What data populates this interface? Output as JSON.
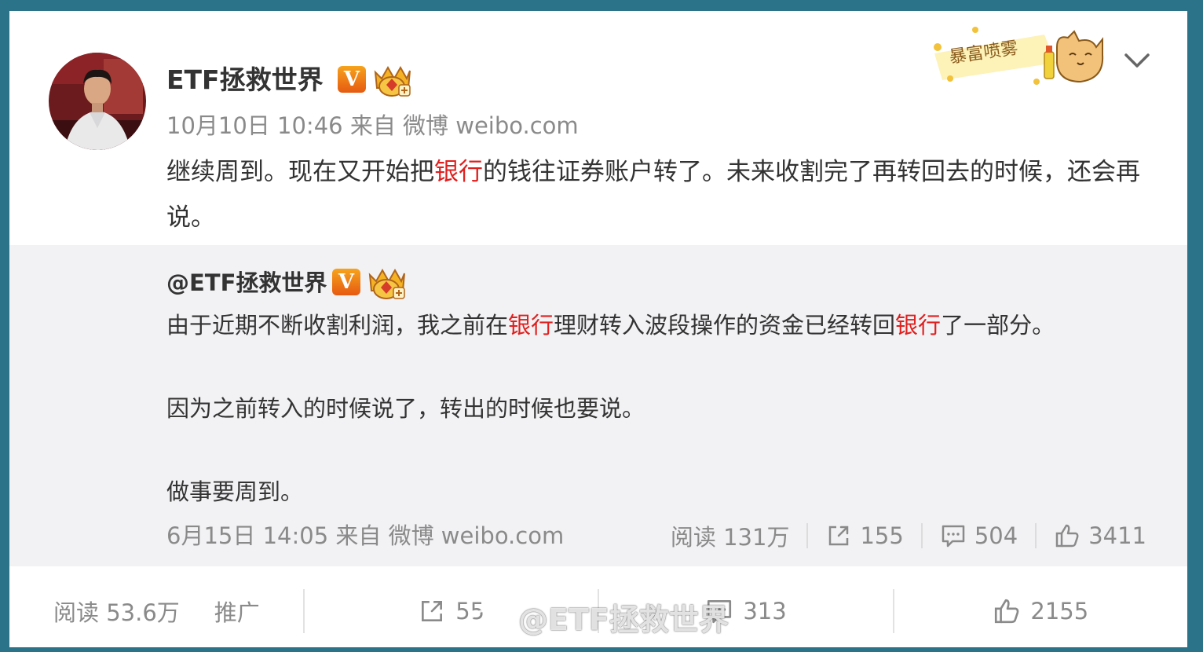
{
  "post": {
    "author": "ETF拯救世界",
    "v_badge": "V",
    "meta": "10月10日 10:46 来自 微博 weibo.com",
    "content": [
      {
        "text": "继续周到。现在又开始把",
        "highlight": false
      },
      {
        "text": "银行",
        "highlight": true
      },
      {
        "text": "的钱往证券账户转了。未来收割完了再转回去的时候，还会再说。",
        "highlight": false
      }
    ],
    "sticker_text": "暴富喷雾"
  },
  "quote": {
    "author": "@ETF拯救世界",
    "v_badge": "V",
    "para1": [
      {
        "text": "由于近期不断收割利润，我之前在",
        "highlight": false
      },
      {
        "text": "银行",
        "highlight": true
      },
      {
        "text": "理财转入波段操作的资金已经转回",
        "highlight": false
      },
      {
        "text": "银行",
        "highlight": true
      },
      {
        "text": "了一部分。",
        "highlight": false
      }
    ],
    "para2": "因为之前转入的时候说了，转出的时候也要说。",
    "para3": "做事要周到。",
    "meta": "6月15日 14:05 来自 微博 weibo.com",
    "reads": "阅读 131万",
    "reposts": "155",
    "comments": "504",
    "likes": "3411"
  },
  "footer": {
    "reads": "阅读 53.6万",
    "promote": "推广",
    "reposts": "55",
    "comments": "313",
    "likes": "2155"
  },
  "watermark": "@ETF拯救世界",
  "colors": {
    "background": "#2b7389",
    "highlight": "#e0201f",
    "quote_bg": "#f2f2f5",
    "muted": "#8a8a8a"
  }
}
